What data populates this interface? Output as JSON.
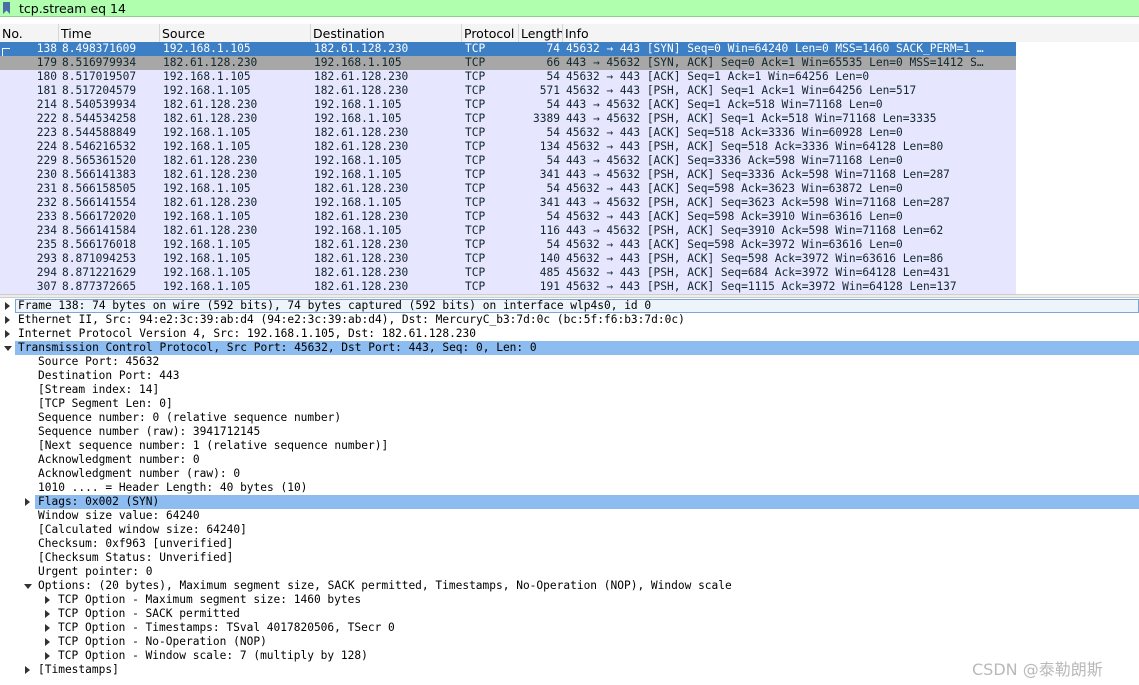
{
  "filter": {
    "text": "tcp.stream eq 14",
    "icon": "bookmark-icon",
    "bg_color": "#afffaf"
  },
  "columns": [
    "No.",
    "Time",
    "Source",
    "Destination",
    "Protocol",
    "Length",
    "Info"
  ],
  "packets": [
    {
      "no": "138",
      "time": "8.498371609",
      "src": "192.168.1.105",
      "dst": "182.61.128.230",
      "proto": "TCP",
      "len": "74",
      "info": "45632 → 443 [SYN] Seq=0 Win=64240 Len=0 MSS=1460 SACK_PERM=1 …",
      "state": "selected"
    },
    {
      "no": "179",
      "time": "8.516979934",
      "src": "182.61.128.230",
      "dst": "192.168.1.105",
      "proto": "TCP",
      "len": "66",
      "info": "443 → 45632 [SYN, ACK] Seq=0 Ack=1 Win=65535 Len=0 MSS=1412 S…",
      "state": "related"
    },
    {
      "no": "180",
      "time": "8.517019507",
      "src": "192.168.1.105",
      "dst": "182.61.128.230",
      "proto": "TCP",
      "len": "54",
      "info": "45632 → 443 [ACK] Seq=1 Ack=1 Win=64256 Len=0",
      "state": ""
    },
    {
      "no": "181",
      "time": "8.517204579",
      "src": "192.168.1.105",
      "dst": "182.61.128.230",
      "proto": "TCP",
      "len": "571",
      "info": "45632 → 443 [PSH, ACK] Seq=1 Ack=1 Win=64256 Len=517",
      "state": ""
    },
    {
      "no": "214",
      "time": "8.540539934",
      "src": "182.61.128.230",
      "dst": "192.168.1.105",
      "proto": "TCP",
      "len": "54",
      "info": "443 → 45632 [ACK] Seq=1 Ack=518 Win=71168 Len=0",
      "state": ""
    },
    {
      "no": "222",
      "time": "8.544534258",
      "src": "182.61.128.230",
      "dst": "192.168.1.105",
      "proto": "TCP",
      "len": "3389",
      "info": "443 → 45632 [PSH, ACK] Seq=1 Ack=518 Win=71168 Len=3335",
      "state": ""
    },
    {
      "no": "223",
      "time": "8.544588849",
      "src": "192.168.1.105",
      "dst": "182.61.128.230",
      "proto": "TCP",
      "len": "54",
      "info": "45632 → 443 [ACK] Seq=518 Ack=3336 Win=60928 Len=0",
      "state": ""
    },
    {
      "no": "224",
      "time": "8.546216532",
      "src": "192.168.1.105",
      "dst": "182.61.128.230",
      "proto": "TCP",
      "len": "134",
      "info": "45632 → 443 [PSH, ACK] Seq=518 Ack=3336 Win=64128 Len=80",
      "state": ""
    },
    {
      "no": "229",
      "time": "8.565361520",
      "src": "182.61.128.230",
      "dst": "192.168.1.105",
      "proto": "TCP",
      "len": "54",
      "info": "443 → 45632 [ACK] Seq=3336 Ack=598 Win=71168 Len=0",
      "state": ""
    },
    {
      "no": "230",
      "time": "8.566141383",
      "src": "182.61.128.230",
      "dst": "192.168.1.105",
      "proto": "TCP",
      "len": "341",
      "info": "443 → 45632 [PSH, ACK] Seq=3336 Ack=598 Win=71168 Len=287",
      "state": ""
    },
    {
      "no": "231",
      "time": "8.566158505",
      "src": "192.168.1.105",
      "dst": "182.61.128.230",
      "proto": "TCP",
      "len": "54",
      "info": "45632 → 443 [ACK] Seq=598 Ack=3623 Win=63872 Len=0",
      "state": ""
    },
    {
      "no": "232",
      "time": "8.566141554",
      "src": "182.61.128.230",
      "dst": "192.168.1.105",
      "proto": "TCP",
      "len": "341",
      "info": "443 → 45632 [PSH, ACK] Seq=3623 Ack=598 Win=71168 Len=287",
      "state": ""
    },
    {
      "no": "233",
      "time": "8.566172020",
      "src": "192.168.1.105",
      "dst": "182.61.128.230",
      "proto": "TCP",
      "len": "54",
      "info": "45632 → 443 [ACK] Seq=598 Ack=3910 Win=63616 Len=0",
      "state": ""
    },
    {
      "no": "234",
      "time": "8.566141584",
      "src": "182.61.128.230",
      "dst": "192.168.1.105",
      "proto": "TCP",
      "len": "116",
      "info": "443 → 45632 [PSH, ACK] Seq=3910 Ack=598 Win=71168 Len=62",
      "state": ""
    },
    {
      "no": "235",
      "time": "8.566176018",
      "src": "192.168.1.105",
      "dst": "182.61.128.230",
      "proto": "TCP",
      "len": "54",
      "info": "45632 → 443 [ACK] Seq=598 Ack=3972 Win=63616 Len=0",
      "state": ""
    },
    {
      "no": "293",
      "time": "8.871094253",
      "src": "192.168.1.105",
      "dst": "182.61.128.230",
      "proto": "TCP",
      "len": "140",
      "info": "45632 → 443 [PSH, ACK] Seq=598 Ack=3972 Win=63616 Len=86",
      "state": ""
    },
    {
      "no": "294",
      "time": "8.871221629",
      "src": "192.168.1.105",
      "dst": "182.61.128.230",
      "proto": "TCP",
      "len": "485",
      "info": "45632 → 443 [PSH, ACK] Seq=684 Ack=3972 Win=64128 Len=431",
      "state": ""
    },
    {
      "no": "307",
      "time": "8.877372665",
      "src": "192.168.1.105",
      "dst": "182.61.128.230",
      "proto": "TCP",
      "len": "191",
      "info": "45632 → 443 [PSH, ACK] Seq=1115 Ack=3972 Win=64128 Len=137",
      "state": ""
    }
  ],
  "details": [
    {
      "indent": 0,
      "arrow": "right",
      "text": "Frame 138: 74 bytes on wire (592 bits), 74 bytes captured (592 bits) on interface wlp4s0, id 0",
      "hl": "box"
    },
    {
      "indent": 0,
      "arrow": "right",
      "text": "Ethernet II, Src: 94:e2:3c:39:ab:d4 (94:e2:3c:39:ab:d4), Dst: MercuryC_b3:7d:0c (bc:5f:f6:b3:7d:0c)",
      "hl": ""
    },
    {
      "indent": 0,
      "arrow": "right",
      "text": "Internet Protocol Version 4, Src: 192.168.1.105, Dst: 182.61.128.230",
      "hl": ""
    },
    {
      "indent": 0,
      "arrow": "down",
      "text": "Transmission Control Protocol, Src Port: 45632, Dst Port: 443, Seq: 0, Len: 0",
      "hl": "full"
    },
    {
      "indent": 1,
      "arrow": "",
      "text": "Source Port: 45632",
      "hl": ""
    },
    {
      "indent": 1,
      "arrow": "",
      "text": "Destination Port: 443",
      "hl": ""
    },
    {
      "indent": 1,
      "arrow": "",
      "text": "[Stream index: 14]",
      "hl": ""
    },
    {
      "indent": 1,
      "arrow": "",
      "text": "[TCP Segment Len: 0]",
      "hl": ""
    },
    {
      "indent": 1,
      "arrow": "",
      "text": "Sequence number: 0    (relative sequence number)",
      "hl": ""
    },
    {
      "indent": 1,
      "arrow": "",
      "text": "Sequence number (raw): 3941712145",
      "hl": ""
    },
    {
      "indent": 1,
      "arrow": "",
      "text": "[Next sequence number: 1    (relative sequence number)]",
      "hl": ""
    },
    {
      "indent": 1,
      "arrow": "",
      "text": "Acknowledgment number: 0",
      "hl": ""
    },
    {
      "indent": 1,
      "arrow": "",
      "text": "Acknowledgment number (raw): 0",
      "hl": ""
    },
    {
      "indent": 1,
      "arrow": "",
      "text": "1010 .... = Header Length: 40 bytes (10)",
      "hl": ""
    },
    {
      "indent": 1,
      "arrow": "right",
      "text": "Flags: 0x002 (SYN)",
      "hl": "full"
    },
    {
      "indent": 1,
      "arrow": "",
      "text": "Window size value: 64240",
      "hl": ""
    },
    {
      "indent": 1,
      "arrow": "",
      "text": "[Calculated window size: 64240]",
      "hl": ""
    },
    {
      "indent": 1,
      "arrow": "",
      "text": "Checksum: 0xf963 [unverified]",
      "hl": ""
    },
    {
      "indent": 1,
      "arrow": "",
      "text": "[Checksum Status: Unverified]",
      "hl": ""
    },
    {
      "indent": 1,
      "arrow": "",
      "text": "Urgent pointer: 0",
      "hl": ""
    },
    {
      "indent": 1,
      "arrow": "down",
      "text": "Options: (20 bytes), Maximum segment size, SACK permitted, Timestamps, No-Operation (NOP), Window scale",
      "hl": ""
    },
    {
      "indent": 2,
      "arrow": "right",
      "text": "TCP Option - Maximum segment size: 1460 bytes",
      "hl": ""
    },
    {
      "indent": 2,
      "arrow": "right",
      "text": "TCP Option - SACK permitted",
      "hl": ""
    },
    {
      "indent": 2,
      "arrow": "right",
      "text": "TCP Option - Timestamps: TSval 4017820506, TSecr 0",
      "hl": ""
    },
    {
      "indent": 2,
      "arrow": "right",
      "text": "TCP Option - No-Operation (NOP)",
      "hl": ""
    },
    {
      "indent": 2,
      "arrow": "right",
      "text": "TCP Option - Window scale: 7 (multiply by 128)",
      "hl": ""
    },
    {
      "indent": 1,
      "arrow": "right",
      "text": "[Timestamps]",
      "hl": ""
    }
  ],
  "watermark": "CSDN @泰勒朗斯",
  "colors": {
    "selected_row": "#3c7fc5",
    "related_row": "#a7a7a7",
    "tcp_row": "#e7e6ff",
    "detail_highlight": "#8cbcf0"
  }
}
